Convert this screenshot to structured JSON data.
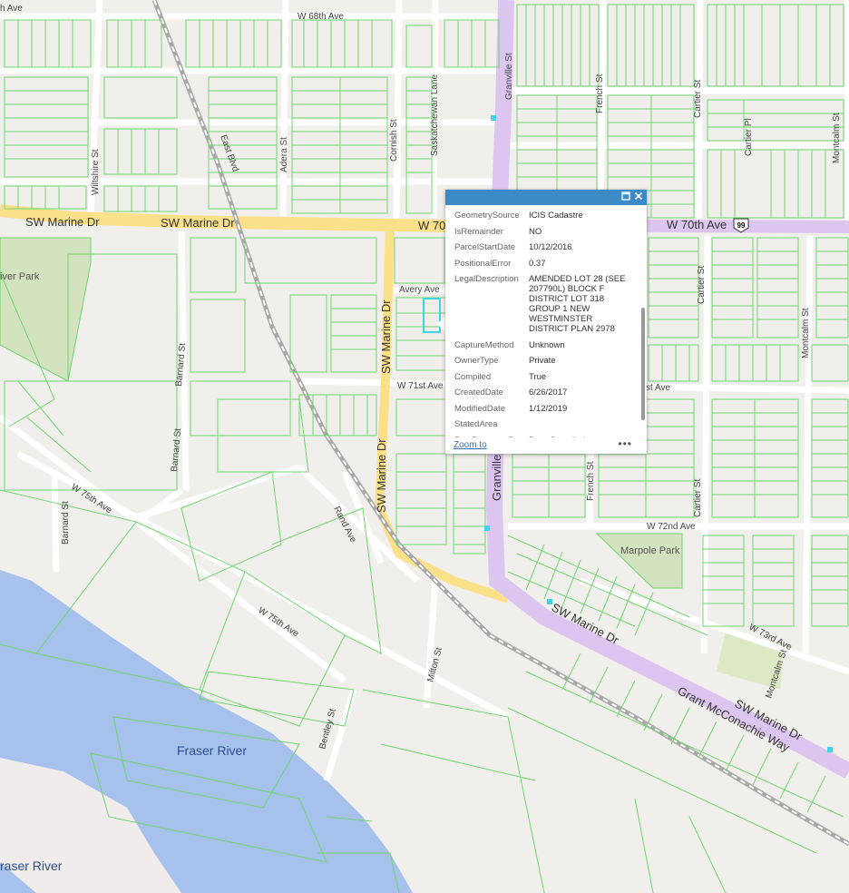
{
  "map": {
    "streets": {
      "sw_marine_dr_1": "SW Marine Dr",
      "sw_marine_dr_2": "SW Marine Dr",
      "w70_left": "W 70",
      "w70_right": "W 70th Ave",
      "w68": "W 68th Ave",
      "avenue_topleft": "h Ave",
      "granville_top": "Granville St",
      "granville_mid": "Granville",
      "french_top": "French St",
      "french_mid": "French St",
      "cartier_top": "Cartier St",
      "cartier_pl": "Cartier Pl",
      "cartier_mid": "Cartier St",
      "cartier_low": "Cartier St",
      "montcalm_top": "Montcalm St",
      "montcalm_mid": "Montcalm St",
      "montcalm_low": "Montcalm St",
      "wiltshire": "Wiltshire St",
      "east_blvd": "East Blvd",
      "adera": "Adera St",
      "cornish": "Cornish St",
      "saskatchewan": "Saskatchewan Lane",
      "avery": "Avery Ave",
      "sw_marine_vert_1": "SW Marine Dr",
      "sw_marine_vert_2": "SW Marine Dr",
      "w71": "W 71st Ave",
      "st_ave_right": "st Ave",
      "barnard_1": "Barnard St",
      "barnard_2": "Barnard St",
      "w75_1": "W 75th Ave",
      "w75_2": "W 75th Ave",
      "rand": "Rand Ave",
      "w72": "W 72nd Ave",
      "w73": "W 73rd Ave",
      "sw_marine_diag": "SW Marine Dr",
      "sw_marine_diag_2": "SW Marine Dr",
      "grant": "Grant McConachie Way",
      "milton": "Milton St",
      "bentley": "Bentley St"
    },
    "highway_shield": "99",
    "parks": {
      "river_park": "iver Park",
      "marpole_park": "Marpole Park"
    },
    "water": {
      "fraser_1": "Fraser River",
      "fraser_2": "raser River"
    },
    "colors": {
      "land": "#f1efec",
      "parcel": "#6ed66e",
      "water": "#a6c1ec",
      "major_road": "#fbe08a",
      "highway": "#dcc6ef",
      "railway": "#a8a8a8",
      "park": "#d3e2bf",
      "selection": "#3ed5e6",
      "popup_header": "#3c8bc6"
    }
  },
  "popup": {
    "fields": [
      {
        "key": "GeometrySource",
        "value": "ICIS Cadastre"
      },
      {
        "key": "IsRemainder",
        "value": "NO"
      },
      {
        "key": "ParcelStartDate",
        "value": "10/12/2016"
      },
      {
        "key": "PositionalError",
        "value": "0.37"
      },
      {
        "key": "LegalDescription",
        "value": "AMENDED LOT 28 (SEE 207790L) BLOCK F DISTRICT LOT 318 GROUP 1 NEW WESTMINSTER DISTRICT PLAN 2978"
      },
      {
        "key": "CaptureMethod",
        "value": "Unknown"
      },
      {
        "key": "OwnerType",
        "value": "Private"
      },
      {
        "key": "Compiled",
        "value": "True"
      },
      {
        "key": "CreatedDate",
        "value": "6/26/2017"
      },
      {
        "key": "ModifiedDate",
        "value": "1/12/2019"
      },
      {
        "key": "StatedArea",
        "value": ""
      },
      {
        "key": "Fee Payment Req",
        "value": "Data Compilation"
      }
    ],
    "zoom_to": "Zoom to",
    "more": "•••",
    "maximize_icon": "maximize-icon",
    "close_icon": "close-icon"
  }
}
